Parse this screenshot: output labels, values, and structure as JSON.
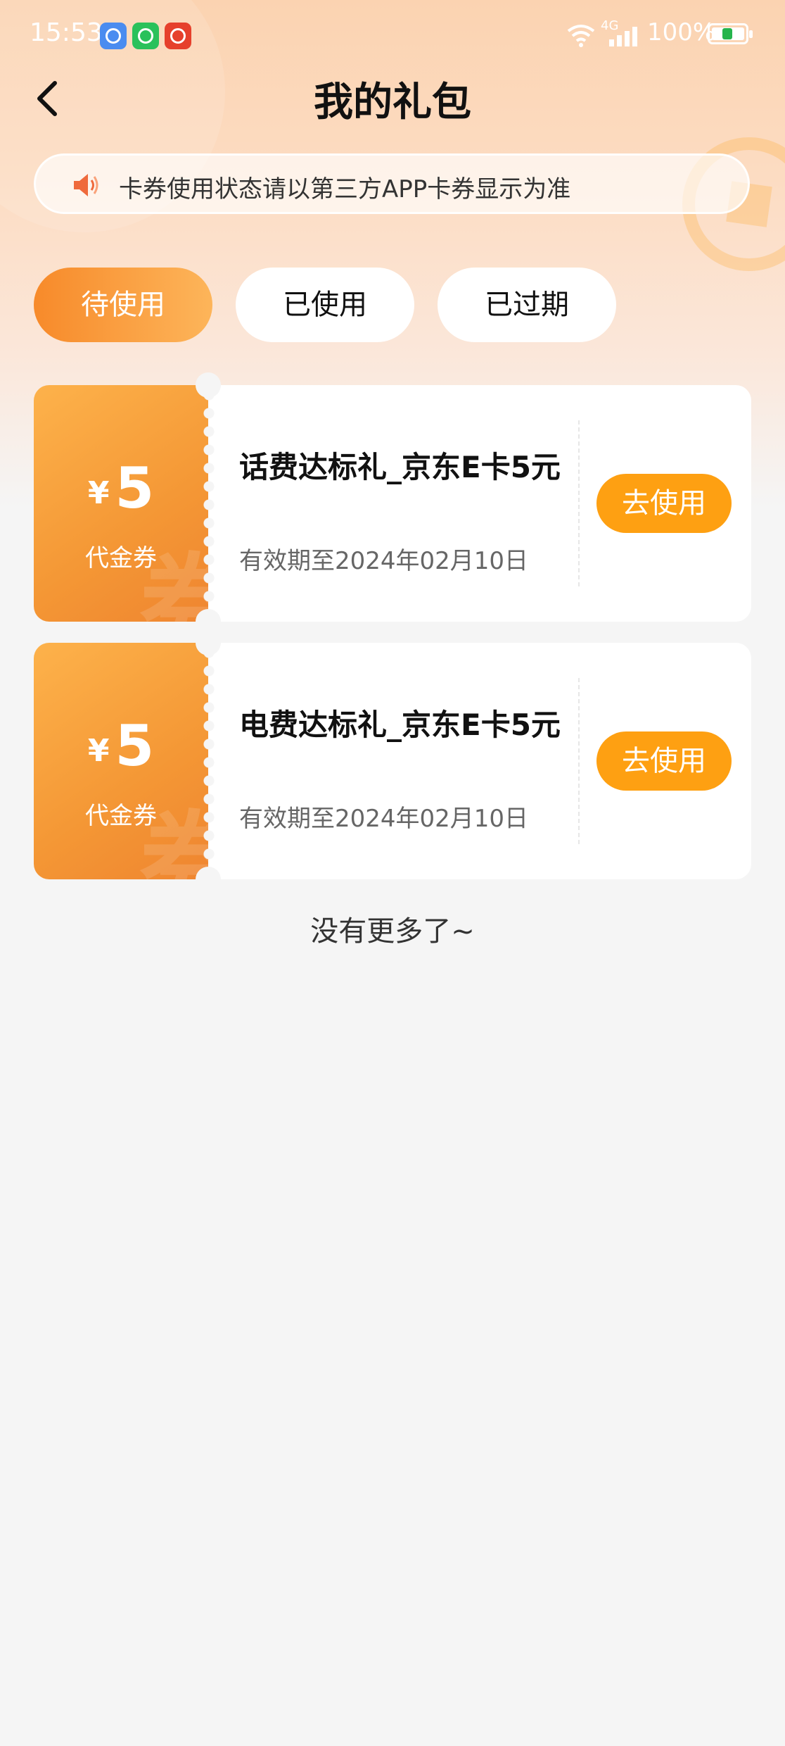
{
  "status_bar": {
    "time": "15:53",
    "signal_label": "4G",
    "battery": "100%"
  },
  "header": {
    "title": "我的礼包"
  },
  "notice": {
    "text": "卡券使用状态请以第三方APP卡券显示为准"
  },
  "tabs": [
    {
      "label": "待使用",
      "active": true
    },
    {
      "label": "已使用",
      "active": false
    },
    {
      "label": "已过期",
      "active": false
    }
  ],
  "coupons": [
    {
      "currency": "¥",
      "amount": "5",
      "type": "代金券",
      "watermark": "券",
      "name": "话费达标礼_京东E卡5元",
      "expiry": "有效期至2024年02月10日",
      "button": "去使用"
    },
    {
      "currency": "¥",
      "amount": "5",
      "type": "代金券",
      "watermark": "券",
      "name": "电费达标礼_京东E卡5元",
      "expiry": "有效期至2024年02月10日",
      "button": "去使用"
    }
  ],
  "footer": {
    "end_text": "没有更多了~"
  },
  "colors": {
    "accent": "#fea012",
    "coupon_orange": "#f49735",
    "tab_active": "#f78a2a"
  }
}
